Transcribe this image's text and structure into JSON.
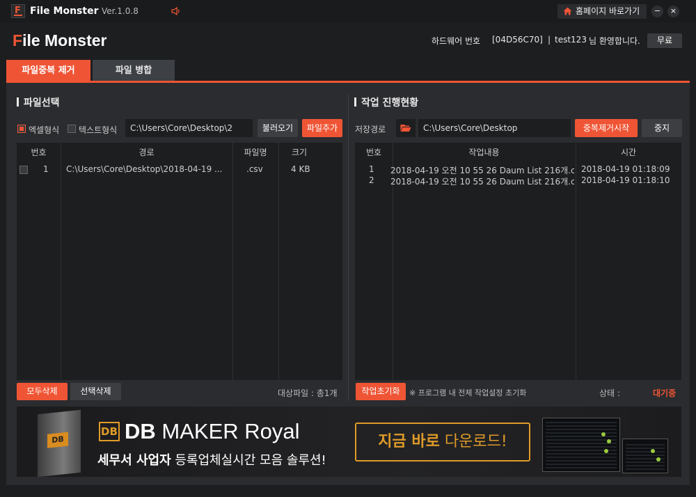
{
  "titlebar": {
    "app_title": "File Monster",
    "version": "Ver.1.0.8",
    "home_button": "홈페이지 바로가기",
    "minimize": "−",
    "close": "×"
  },
  "header": {
    "brand_first": "F",
    "brand_rest": "ile Monster",
    "hw_label": "하드웨어 번호",
    "hw_code": "[04D56C70]",
    "separator": "|",
    "user": "test123",
    "welcome": "님 환영합니다.",
    "plan_button": "무료"
  },
  "tabs": [
    {
      "label": "파일중복 제거",
      "active": true
    },
    {
      "label": "파일 병합",
      "active": false
    }
  ],
  "file_select": {
    "title": "파일선택",
    "excel_label": "엑셀형식",
    "text_label": "텍스트형식",
    "path_value": "C:\\Users\\Core\\Desktop\\2",
    "load_button": "불러오기",
    "add_button": "파일추가",
    "columns": [
      "번호",
      "경로",
      "파일명",
      "크기"
    ],
    "rows": [
      {
        "no": "1",
        "path": "C:\\Users\\Core\\Desktop\\2018-04-19 ...",
        "name": ".csv",
        "size": "4 KB"
      }
    ],
    "delete_all_button": "모두삭제",
    "delete_selected_button": "선택삭제",
    "target_files": "대상파일 : 총1개"
  },
  "progress": {
    "title": "작업 진행현황",
    "save_path_label": "저장경로",
    "save_path_value": "C:\\Users\\Core\\Desktop",
    "start_button": "중복제거시작",
    "stop_button": "중지",
    "columns": [
      "번호",
      "작업내용",
      "시간"
    ],
    "rows": [
      {
        "no": "1",
        "content": "2018-04-19 오전 10 55 26 Daum List  216개.c...",
        "time": "2018-04-19 01:18:09"
      },
      {
        "no": "2",
        "content": "2018-04-19 오전 10 55 26 Daum List  216개.c...",
        "time": "2018-04-19 01:18:10"
      }
    ],
    "reset_button": "작업초기화",
    "reset_note": "※ 프로그램 내 전체 작업설정 초기화",
    "status_label": "상태 :",
    "status_value": "대기중"
  },
  "banner": {
    "box_logo": "DB",
    "badge": "DB",
    "product_bold": "DB",
    "product_rest": " MAKER Royal",
    "slogan_bold": "세무서 사업자",
    "slogan_rest": " 등록업체실시간 모음 솔루션!",
    "cta_bold": "지금 바로",
    "cta_rest": " 다운로드!"
  },
  "colors": {
    "accent": "#ef5535",
    "panel": "#2b2c2f",
    "table_bg": "#1d1e20",
    "banner_gold": "#e09b28"
  }
}
